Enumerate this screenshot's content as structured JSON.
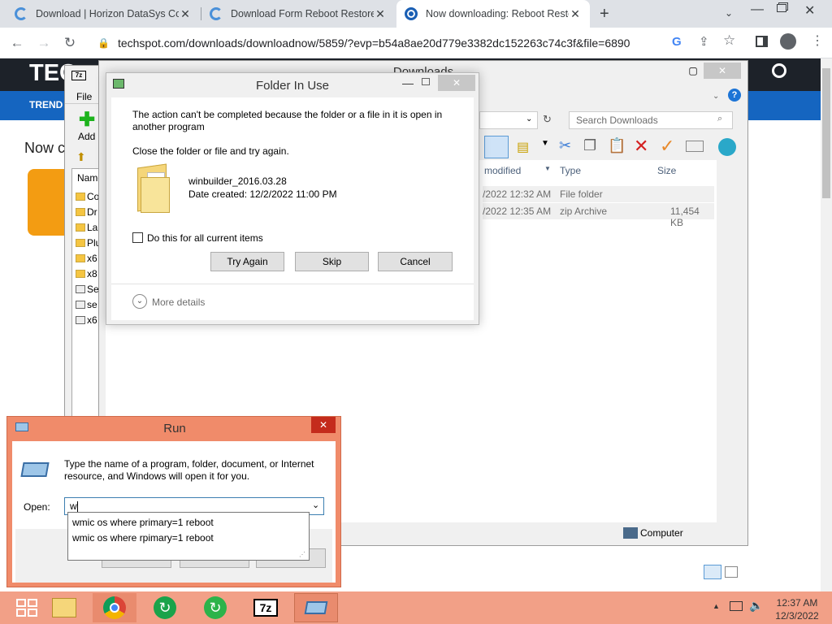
{
  "browser": {
    "tabs": [
      {
        "title": "Download | Horizon DataSys Cor",
        "active": false
      },
      {
        "title": "Download Form Reboot Restore",
        "active": false
      },
      {
        "title": "Now downloading: Reboot Resto",
        "active": true
      }
    ],
    "new_tab": "+",
    "address": "techspot.com/downloads/downloadnow/5859/?evp=b54a8ae20d779e3382dc152263c74c3f&file=6890"
  },
  "page": {
    "logo": "TEC",
    "nav_label": "TREND",
    "heading": "Now c"
  },
  "sevenzip": {
    "menu_file": "File",
    "add_label": "Add",
    "list_header": "Name",
    "items": [
      "Co",
      "Dr",
      "La",
      "Plu",
      "x6",
      "x8",
      "Se",
      "se",
      "x6"
    ]
  },
  "explorer": {
    "title": "Downloads",
    "search_placeholder": "Search Downloads",
    "columns": {
      "modified": "modified",
      "type": "Type",
      "size": "Size"
    },
    "rows": [
      {
        "modified": "/2022 12:32 AM",
        "type": "File folder",
        "size": ""
      },
      {
        "modified": "/2022 12:35 AM",
        "type": "zip Archive",
        "size": "11,454 KB"
      }
    ],
    "status": "Computer"
  },
  "dialog": {
    "title": "Folder In Use",
    "message": "The action can't be completed because the folder or a file in it is open in another program",
    "instruction": "Close the folder or file and try again.",
    "file_name": "winbuilder_2016.03.28",
    "file_date": "Date created: 12/2/2022 11:00 PM",
    "checkbox_label": "Do this for all current items",
    "btn_retry": "Try Again",
    "btn_skip": "Skip",
    "btn_cancel": "Cancel",
    "more_details": "More details"
  },
  "run": {
    "title": "Run",
    "description": "Type the name of a program, folder, document, or Internet resource, and Windows will open it for you.",
    "open_label": "Open:",
    "input_value": "w",
    "suggestions": [
      "wmic os where primary=1 reboot",
      "wmic os where rpimary=1 reboot"
    ]
  },
  "taskbar": {
    "time": "12:37 AM",
    "date": "12/3/2022",
    "sevenzip_icon_text": "7z"
  },
  "colors": {
    "run_frame": "#f08b6a",
    "taskbar": "#f2a087",
    "techspot_nav": "#1565c0",
    "accent": "#0078d7"
  }
}
